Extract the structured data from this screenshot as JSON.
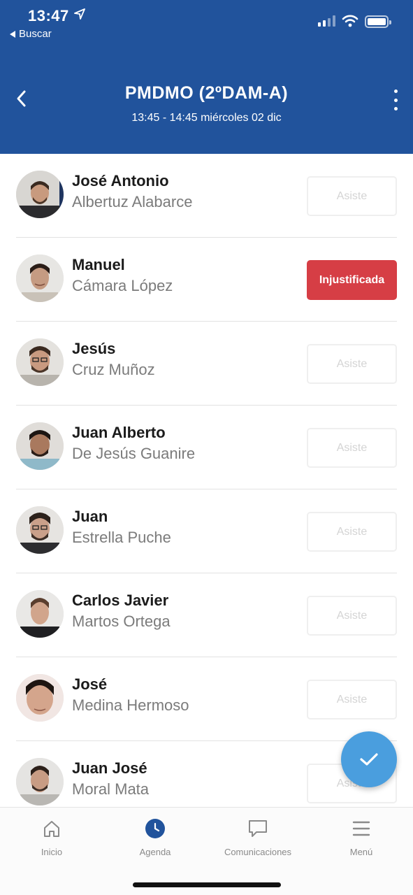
{
  "status_bar": {
    "time": "13:47",
    "back_label": "Buscar"
  },
  "header": {
    "title": "PMDMO (2ºDAM-A)",
    "subtitle": "13:45 - 14:45 miércoles 02 dic"
  },
  "students": [
    {
      "first_name": "José Antonio",
      "last_name": "Albertuz Alabarce",
      "status": "Asiste",
      "status_type": "default"
    },
    {
      "first_name": "Manuel",
      "last_name": "Cámara López",
      "status": "Injustificada",
      "status_type": "unjustified"
    },
    {
      "first_name": "Jesús",
      "last_name": "Cruz Muñoz",
      "status": "Asiste",
      "status_type": "default"
    },
    {
      "first_name": "Juan Alberto",
      "last_name": "De Jesús Guanire",
      "status": "Asiste",
      "status_type": "default"
    },
    {
      "first_name": "Juan",
      "last_name": "Estrella Puche",
      "status": "Asiste",
      "status_type": "default"
    },
    {
      "first_name": "Carlos Javier",
      "last_name": "Martos Ortega",
      "status": "Asiste",
      "status_type": "default"
    },
    {
      "first_name": "José",
      "last_name": "Medina Hermoso",
      "status": "Asiste",
      "status_type": "default"
    },
    {
      "first_name": "Juan José",
      "last_name": "Moral Mata",
      "status": "Asiste",
      "status_type": "default"
    }
  ],
  "tabs": [
    {
      "label": "Inicio",
      "icon": "home-icon",
      "active": false
    },
    {
      "label": "Agenda",
      "icon": "clock-icon",
      "active": true
    },
    {
      "label": "Comunicaciones",
      "icon": "chat-icon",
      "active": false
    },
    {
      "label": "Menú",
      "icon": "menu-icon",
      "active": false
    }
  ],
  "colors": {
    "header_bg": "#21539c",
    "unjustified": "#d63e45",
    "fab": "#4a9ede",
    "active_tab": "#21539c"
  }
}
